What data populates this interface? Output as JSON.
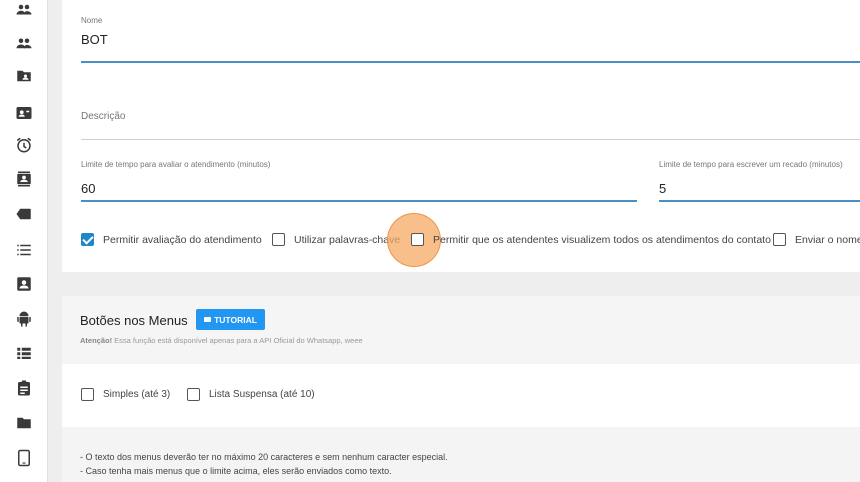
{
  "sidebar": {
    "icons": [
      {
        "name": "users-icon"
      },
      {
        "name": "group-icon"
      },
      {
        "name": "folder-account-icon"
      },
      {
        "name": "contact-card-icon"
      },
      {
        "name": "alarm-icon"
      },
      {
        "name": "contacts-book-icon"
      },
      {
        "name": "tag-icon"
      },
      {
        "name": "list-icon"
      },
      {
        "name": "account-box-icon"
      },
      {
        "name": "android-icon"
      },
      {
        "name": "view-list-icon"
      },
      {
        "name": "clipboard-icon"
      },
      {
        "name": "folder-icon"
      },
      {
        "name": "tablet-icon"
      }
    ]
  },
  "form": {
    "name_label": "Nome",
    "name_value": "BOT",
    "description_placeholder": "Descrição",
    "eval_time_label": "Limite de tempo para avaliar o atendimento (minutos)",
    "eval_time_value": "60",
    "write_time_label": "Limite de tempo para escrever um recado (minutos)",
    "write_time_value": "5"
  },
  "checkboxes": [
    {
      "label": "Permitir avaliação do atendimento",
      "checked": true
    },
    {
      "label": "Utilizar palavras-chave",
      "checked": false
    },
    {
      "label": "Permitir que os atendentes visualizem todos os atendimentos do contato",
      "checked": false
    },
    {
      "label": "Enviar o nome",
      "checked": false
    }
  ],
  "menus": {
    "title": "Botões nos Menus",
    "tutorial_label": "TUTORIAL",
    "attention_bold": "Atenção!",
    "attention_text": " Essa função está disponível apenas para a API Oficial do Whatsapp, weee",
    "options": [
      {
        "label": "Simples (até 3)",
        "checked": false
      },
      {
        "label": "Lista Suspensa (até 10)",
        "checked": false
      }
    ],
    "notes": [
      "- O texto dos menus deverão ter no máximo 20 caracteres e sem nenhum caracter especial.",
      "- Caso tenha mais menus que o limite acima, eles serão enviados como texto."
    ]
  },
  "colors": {
    "accent": "#2196f3",
    "checkbox_checked": "#1e88c7",
    "underline_active": "#4a8fc4",
    "cursor_highlight": "#f6aa64"
  }
}
